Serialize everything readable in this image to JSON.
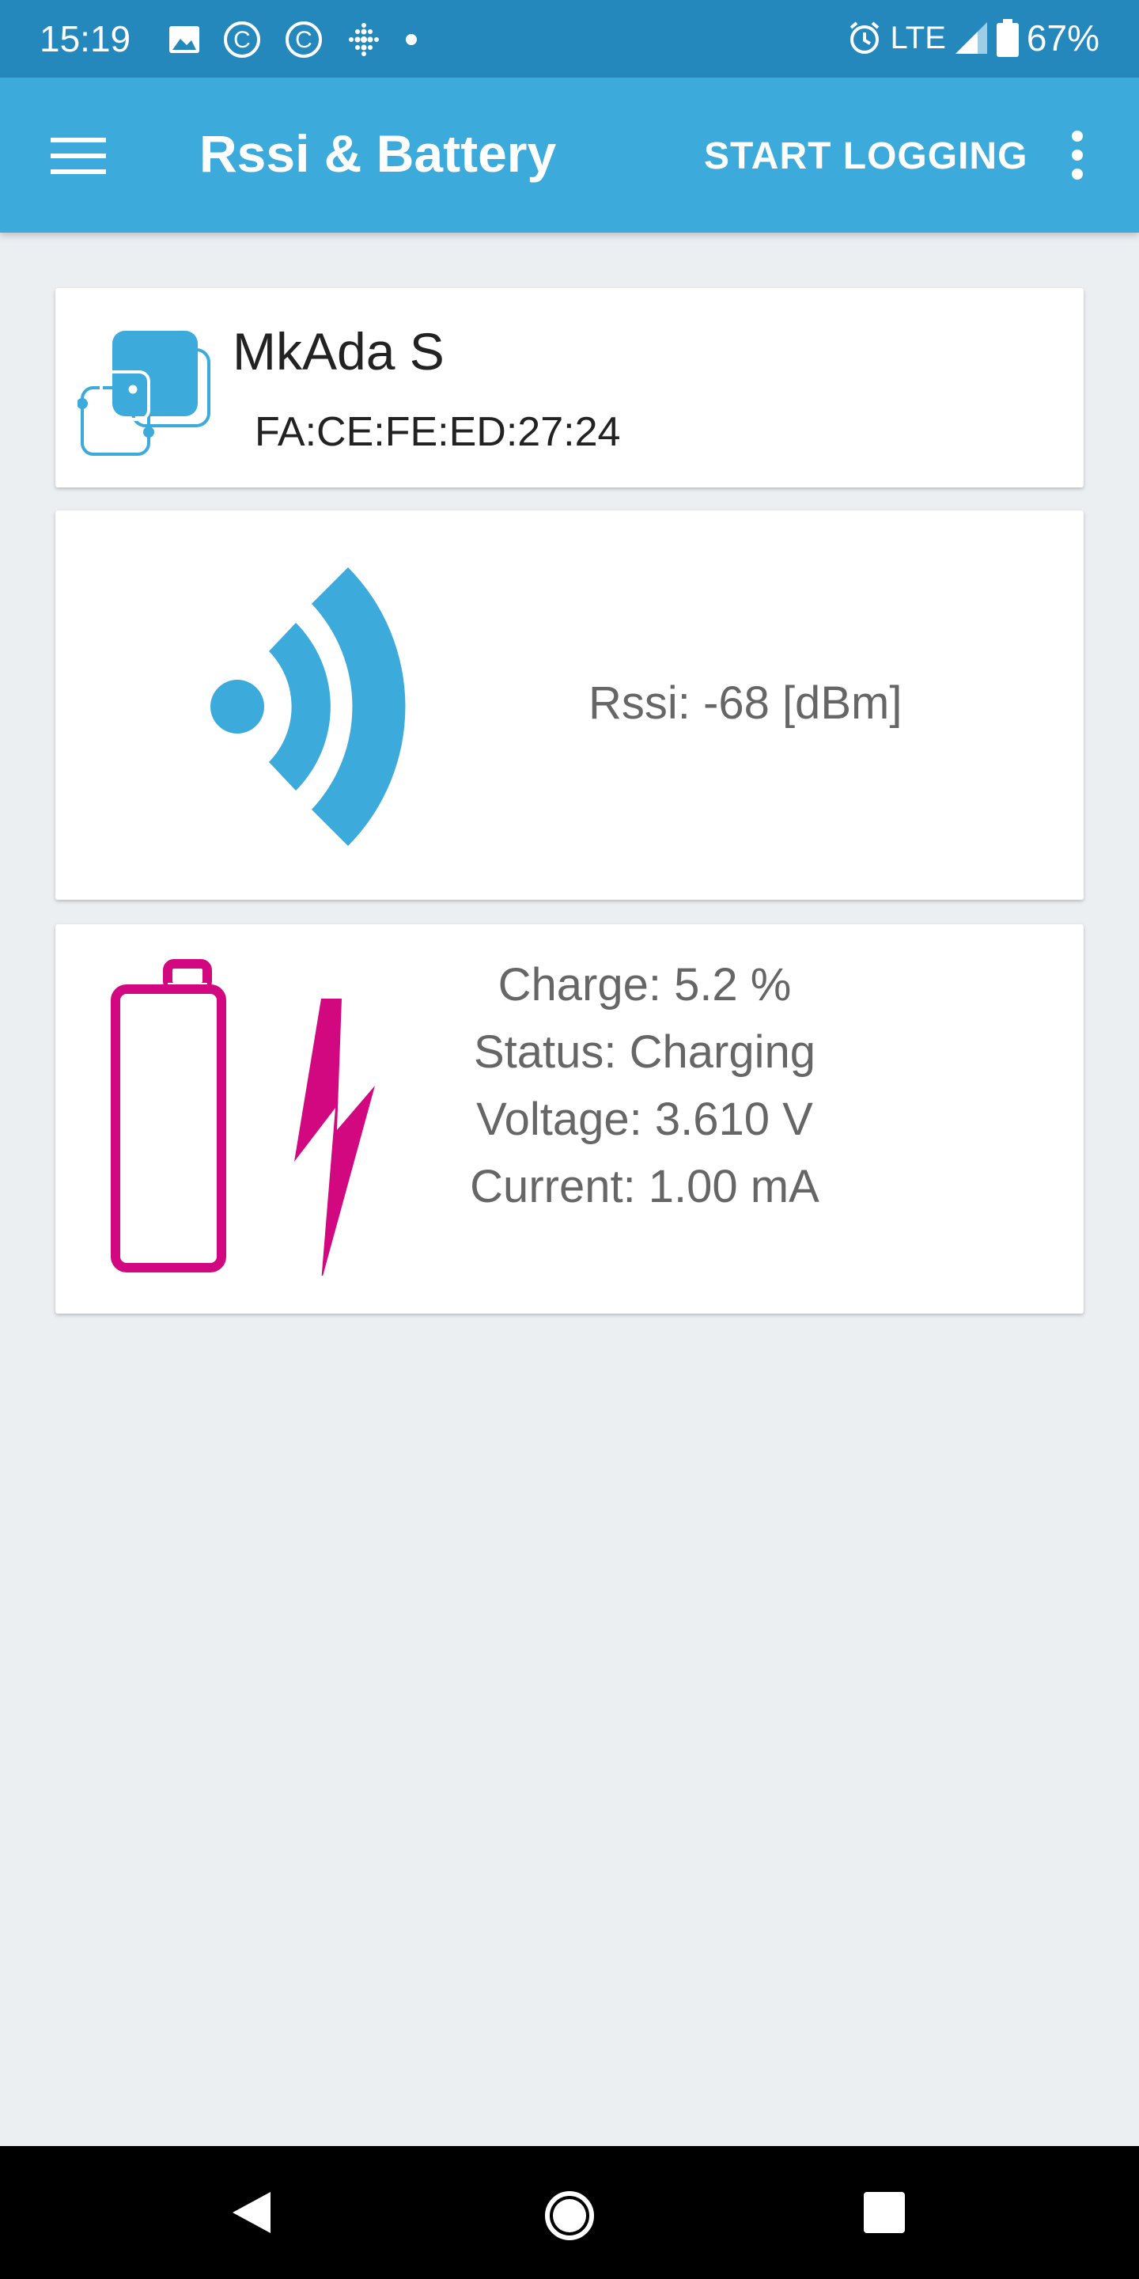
{
  "status_bar": {
    "time": "15:19",
    "network": "LTE",
    "battery_percent": "67%",
    "icons_left": [
      "image-icon",
      "c-circle-icon",
      "c-circle-icon",
      "dots-grid-icon",
      "dot-icon"
    ],
    "icons_right": [
      "alarm-icon",
      "signal-icon",
      "battery-icon"
    ]
  },
  "app_bar": {
    "title": "Rssi & Battery",
    "action_label": "START LOGGING",
    "color": "#3caadb"
  },
  "device": {
    "name": "MkAda S",
    "mac": "FA:CE:FE:ED:27:24"
  },
  "rssi": {
    "text": "Rssi: -68 [dBm]",
    "icon_color": "#3caadb"
  },
  "battery": {
    "charge": "Charge: 5.2 %",
    "status": "Status: Charging",
    "voltage": "Voltage: 3.610 V",
    "current": "Current: 1.00 mA",
    "icon_color": "#d1087f"
  },
  "nav_bar": {
    "buttons": [
      "back-icon",
      "home-icon",
      "recent-apps-icon"
    ]
  }
}
